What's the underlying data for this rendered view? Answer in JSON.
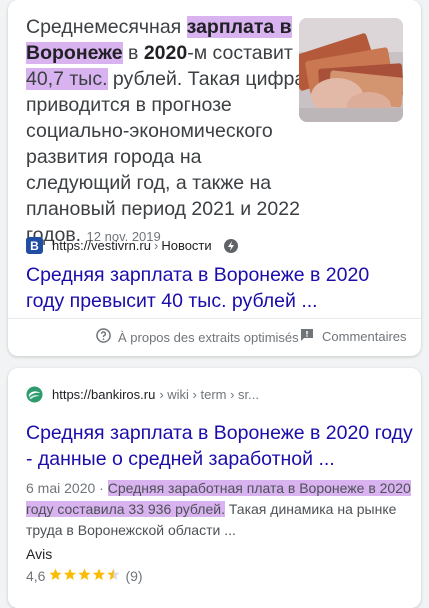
{
  "result1": {
    "snippet": {
      "p1": "Среднемесячная ",
      "p2": "зарплата в",
      "p3": "Воронеже",
      "p4": " в ",
      "p5": "2020",
      "p6": "-м составит ",
      "p7": "40,7 тыс.",
      "p8": " рублей. Такая цифра приводится в прогнозе социально-экономического развития города на следующий год, а также на плановый период 2021 и 2022 годов.",
      "date": "12 nov. 2019"
    },
    "favicon_letter": "B",
    "source_url": "https://vestivrn.ru",
    "source_sep": "›",
    "source_section": "Новости",
    "title": "Средняя зарплата в Воронеже в 2020 году превысит 40 тыс. рублей ...",
    "footer": {
      "about": "À propos des extraits optimisés",
      "feedback": "Commentaires"
    }
  },
  "result2": {
    "source_url": "https://bankiros.ru",
    "breadcrumb": "› wiki › term › sr...",
    "title": "Средняя зарплата в Воронеже в 2020 году - данные о средней заработной ...",
    "date": "6 mai 2020",
    "date_sep": " · ",
    "snippet_hl": "Средняя заработная плата в Воронеже в 2020 году составила 33 936 рублей.",
    "snippet_rest": " Такая динамика на рынке труда в Воронежской области ...",
    "avis_label": "Avis",
    "rating_value": "4,6",
    "rating_stars": 4.5,
    "rating_count": "(9)"
  }
}
